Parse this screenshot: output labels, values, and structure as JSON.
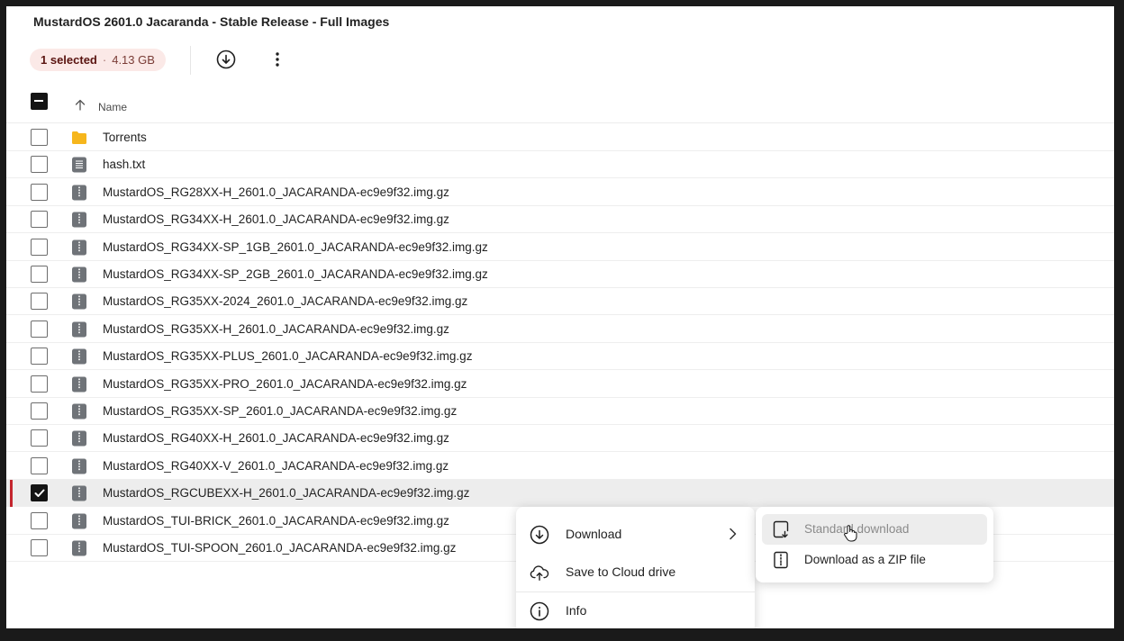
{
  "folder_title": "MustardOS 2601.0 Jacaranda - Stable Release - Full Images",
  "toolbar": {
    "selected_label": "1 selected",
    "dot": "·",
    "selected_size": "4.13 GB",
    "download_icon": "download-circle-icon",
    "more_icon": "more-vertical-icon"
  },
  "table": {
    "column_name": "Name",
    "sort_icon": "arrow-up-icon",
    "rows": [
      {
        "name": "Torrents",
        "type": "folder"
      },
      {
        "name": "hash.txt",
        "type": "text"
      },
      {
        "name": "MustardOS_RG28XX-H_2601.0_JACARANDA-ec9e9f32.img.gz",
        "type": "archive"
      },
      {
        "name": "MustardOS_RG34XX-H_2601.0_JACARANDA-ec9e9f32.img.gz",
        "type": "archive"
      },
      {
        "name": "MustardOS_RG34XX-SP_1GB_2601.0_JACARANDA-ec9e9f32.img.gz",
        "type": "archive"
      },
      {
        "name": "MustardOS_RG34XX-SP_2GB_2601.0_JACARANDA-ec9e9f32.img.gz",
        "type": "archive"
      },
      {
        "name": "MustardOS_RG35XX-2024_2601.0_JACARANDA-ec9e9f32.img.gz",
        "type": "archive"
      },
      {
        "name": "MustardOS_RG35XX-H_2601.0_JACARANDA-ec9e9f32.img.gz",
        "type": "archive"
      },
      {
        "name": "MustardOS_RG35XX-PLUS_2601.0_JACARANDA-ec9e9f32.img.gz",
        "type": "archive"
      },
      {
        "name": "MustardOS_RG35XX-PRO_2601.0_JACARANDA-ec9e9f32.img.gz",
        "type": "archive"
      },
      {
        "name": "MustardOS_RG35XX-SP_2601.0_JACARANDA-ec9e9f32.img.gz",
        "type": "archive"
      },
      {
        "name": "MustardOS_RG40XX-H_2601.0_JACARANDA-ec9e9f32.img.gz",
        "type": "archive"
      },
      {
        "name": "MustardOS_RG40XX-V_2601.0_JACARANDA-ec9e9f32.img.gz",
        "type": "archive"
      },
      {
        "name": "MustardOS_RGCUBEXX-H_2601.0_JACARANDA-ec9e9f32.img.gz",
        "type": "archive",
        "selected": true
      },
      {
        "name": "MustardOS_TUI-BRICK_2601.0_JACARANDA-ec9e9f32.img.gz",
        "type": "archive"
      },
      {
        "name": "MustardOS_TUI-SPOON_2601.0_JACARANDA-ec9e9f32.img.gz",
        "type": "archive"
      }
    ]
  },
  "context_menu": {
    "download": "Download",
    "save_cloud": "Save to Cloud drive",
    "info": "Info"
  },
  "download_submenu": {
    "standard": "Standard download",
    "zip": "Download as a ZIP file"
  },
  "colors": {
    "accent_red": "#c4262e",
    "chip_bg": "#fbe9e7",
    "folder_yellow": "#f6b61c",
    "file_icon_gray": "#6f7378"
  }
}
